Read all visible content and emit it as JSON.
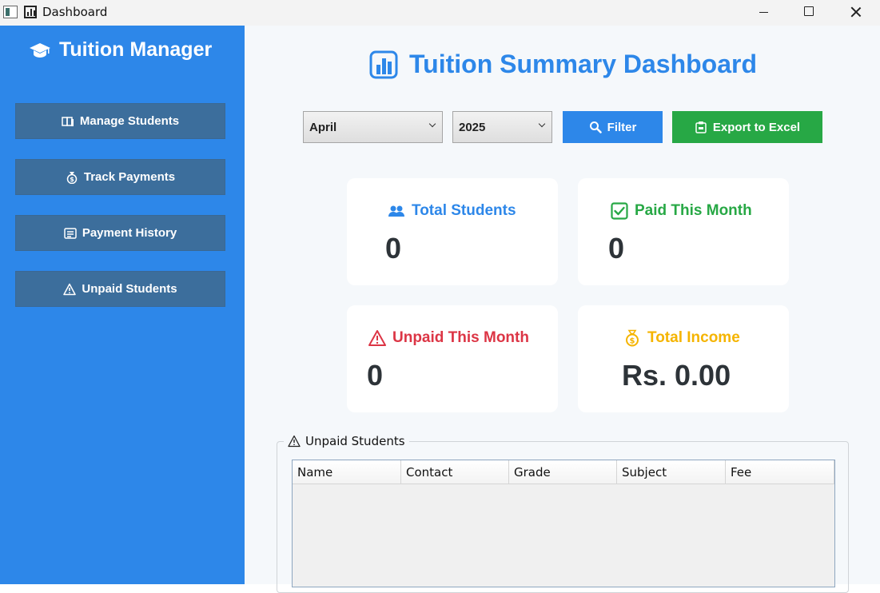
{
  "window": {
    "title": "Dashboard"
  },
  "sidebar": {
    "brand": "Tuition Manager",
    "items": [
      {
        "label": "Manage Students",
        "icon": "books-icon"
      },
      {
        "label": "Track Payments",
        "icon": "money-bag-icon"
      },
      {
        "label": "Payment History",
        "icon": "ledger-icon"
      },
      {
        "label": "Unpaid Students",
        "icon": "warning-icon"
      }
    ]
  },
  "main": {
    "title": "Tuition Summary Dashboard",
    "filters": {
      "month": "April",
      "year": "2025",
      "filter_label": "Filter",
      "export_label": "Export to Excel"
    },
    "cards": [
      {
        "title": "Total Students",
        "value": "0",
        "color": "#2d87e9"
      },
      {
        "title": "Paid This Month",
        "value": "0",
        "color": "#27a845"
      },
      {
        "title": "Unpaid This Month",
        "value": "0",
        "color": "#dc3545"
      },
      {
        "title": "Total Income",
        "value": "Rs. 0.00",
        "color": "#f5b400"
      }
    ],
    "unpaid_group": {
      "legend": "Unpaid Students",
      "columns": [
        "Name",
        "Contact",
        "Grade",
        "Subject",
        "Fee"
      ],
      "rows": []
    }
  },
  "colors": {
    "sidebar": "#2d87e9",
    "nav_button": "#3c6e9c",
    "accent": "#2d87e9",
    "export": "#27a845"
  }
}
